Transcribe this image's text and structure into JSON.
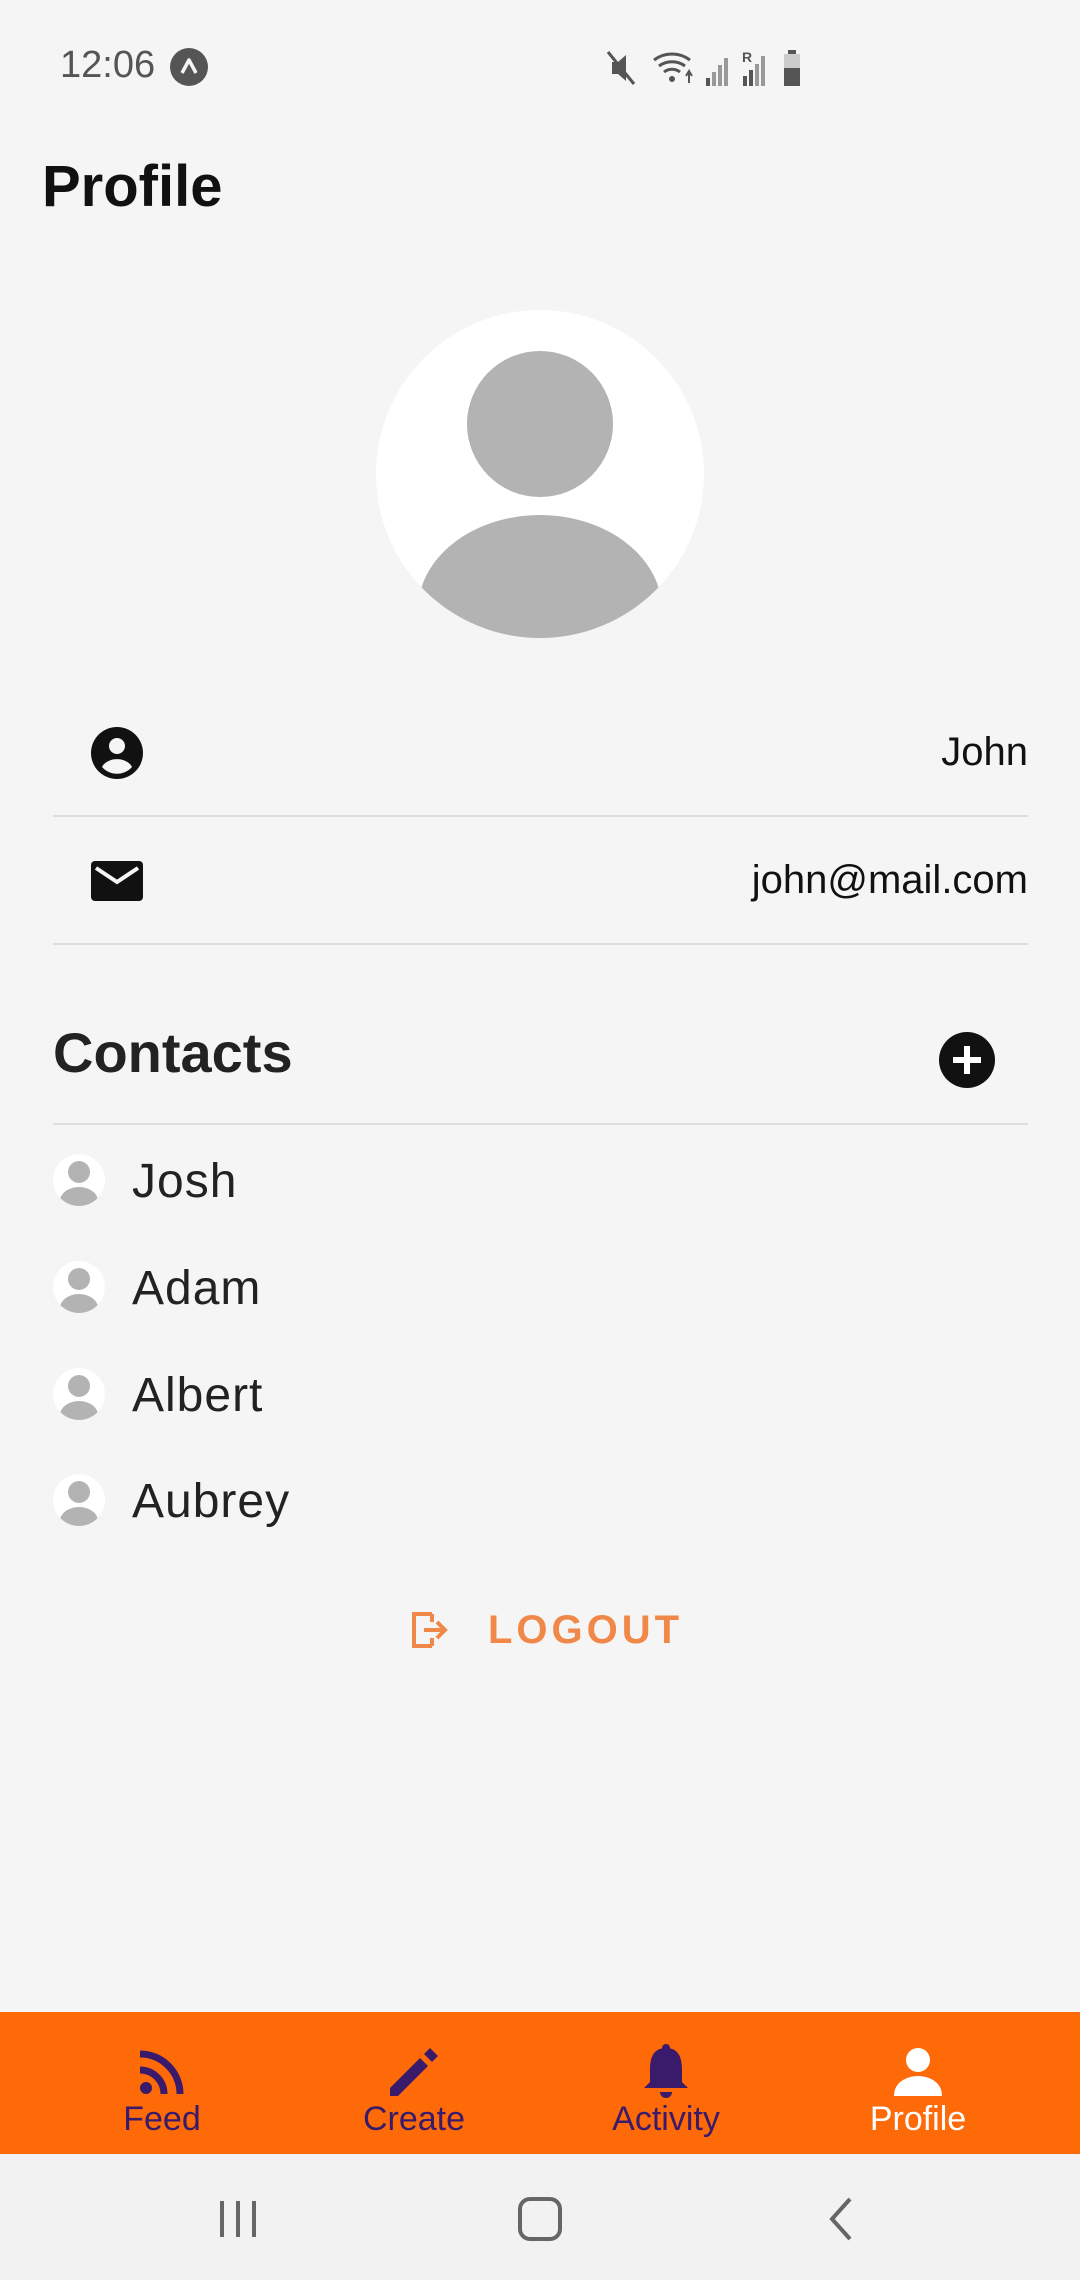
{
  "status_bar": {
    "time": "12:06",
    "icons": [
      "app-notification-icon",
      "mute-icon",
      "wifi-icon",
      "signal-icon",
      "signal-roaming-icon",
      "battery-icon"
    ]
  },
  "page": {
    "title": "Profile"
  },
  "profile": {
    "avatar": "default-avatar-icon",
    "name": "John",
    "email": "john@mail.com"
  },
  "contacts": {
    "title": "Contacts",
    "add_icon": "add-circle-icon",
    "items": [
      {
        "name": "Josh"
      },
      {
        "name": "Adam"
      },
      {
        "name": "Albert"
      },
      {
        "name": "Aubrey"
      }
    ]
  },
  "logout": {
    "label": "LOGOUT",
    "icon": "logout-icon"
  },
  "bottom_nav": {
    "items": [
      {
        "label": "Feed",
        "icon": "rss-icon",
        "active": false
      },
      {
        "label": "Create",
        "icon": "pencil-icon",
        "active": false
      },
      {
        "label": "Activity",
        "icon": "bell-icon",
        "active": false
      },
      {
        "label": "Profile",
        "icon": "person-icon",
        "active": true
      }
    ]
  },
  "colors": {
    "accent": "#ff6a08",
    "nav_inactive": "#3a1a6a",
    "logout": "#f0884a",
    "background": "#f5f5f5"
  }
}
